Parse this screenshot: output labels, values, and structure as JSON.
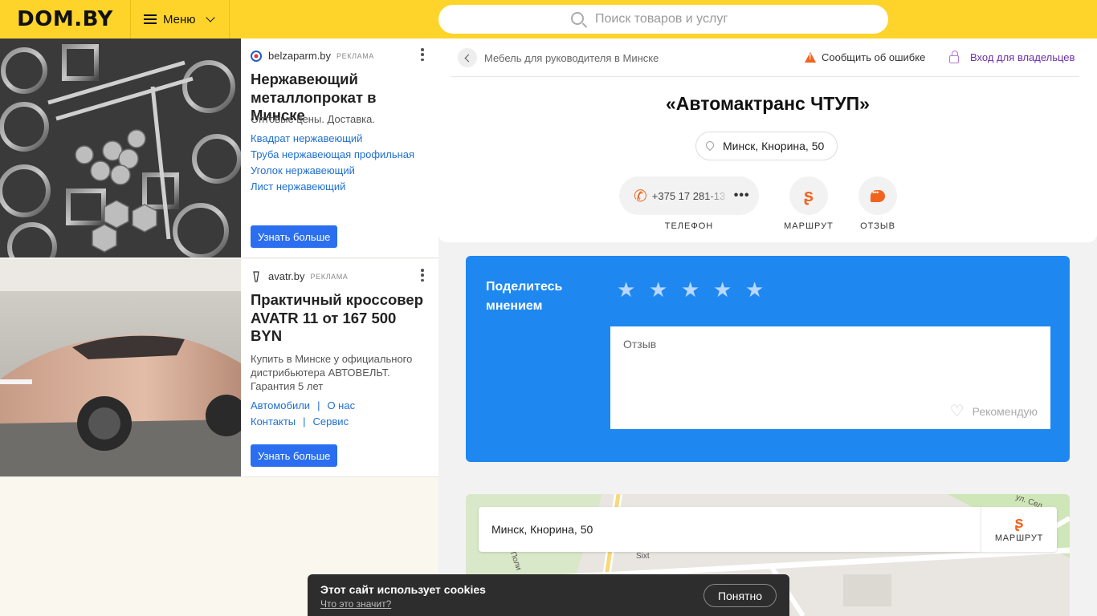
{
  "header": {
    "logo": "DOM.BY",
    "menu_label": "Меню",
    "search_placeholder": "Поиск товаров и услуг"
  },
  "ads": [
    {
      "source": "belzaparm.by",
      "tag": "реклама",
      "title": "Нержавеющий металлопрокат в Минске",
      "description": "Оптовые цены. Доставка.",
      "links": [
        "Квадрат нержавеющий",
        "Труба нержавеющая профильная",
        "Уголок нержавеющий",
        "Лист нержавеющий"
      ],
      "button": "Узнать больше"
    },
    {
      "source": "avatr.by",
      "tag": "реклама",
      "title": "Практичный кроссовер AVATR 11 от 167 500 BYN",
      "description": "Купить в Минске у официального дистрибьютера АВТОВЕЛЬТ. Гарантия 5 лет",
      "links": [
        "Автомобили",
        "О нас",
        "Контакты",
        "Сервис"
      ],
      "button": "Узнать больше"
    }
  ],
  "card": {
    "breadcrumb": "Мебель для руководителя в Минске",
    "report_label": "Сообщить об ошибке",
    "owner_label": "Вход для владельцев",
    "company_name": "«Автомактранс ЧТУП»",
    "address": "Минск, Кнорина, 50",
    "phone": "+375 17 281-13",
    "actions": {
      "phone": "ТЕЛЕФОН",
      "route": "МАРШРУТ",
      "review": "ОТЗЫВ"
    }
  },
  "review": {
    "title": "Поделитесь мнением",
    "stars_total": 5,
    "placeholder": "Отзыв",
    "recommend_label": "Рекомендую"
  },
  "map": {
    "address": "Минск, Кнорина, 50",
    "route_label": "МАРШРУТ",
    "labels": [
      "ул. Сел",
      "Sixt",
      "Поли"
    ]
  },
  "cookie": {
    "title": "Этот сайт использует cookies",
    "link": "Что это значит?",
    "button": "Понятно"
  },
  "colors": {
    "header": "#fed42b",
    "accent_orange": "#f0641e",
    "review_blue": "#1e88f0",
    "ad_button": "#2b6ff0",
    "owner_link": "#6c2fa8"
  }
}
